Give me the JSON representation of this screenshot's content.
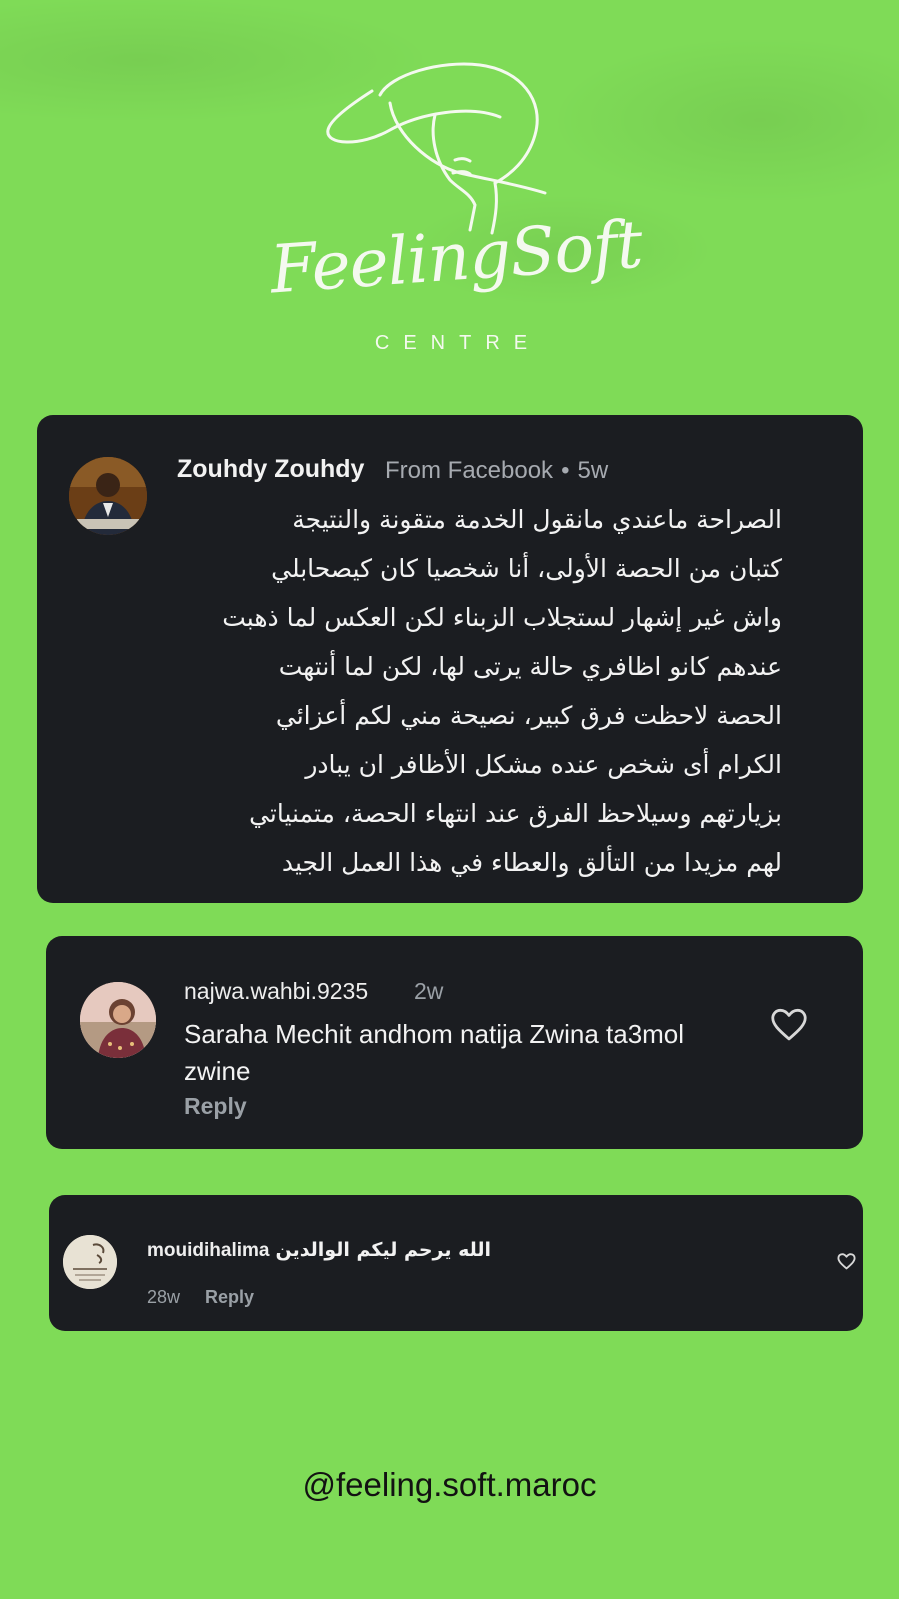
{
  "brand": {
    "title": "FeelingSoft",
    "subtitle": "CENTRE",
    "logo_icon": "woman-hat-icon",
    "background_color": "#7fdb57",
    "card_color": "#1b1d21"
  },
  "comments": [
    {
      "author": "Zouhdy Zouhdy",
      "source": "From Facebook",
      "separator": "•",
      "time": "5w",
      "avatar_icon": "avatar",
      "lines": [
        "الصراحة ماعندي مانقول الخدمة متقونة والنتيجة",
        "كتبان من الحصة الأولى، أنا شخصيا كان كيصحابلي",
        "واش غير إشهار لستجلاب الزبناء لكن العكس لما ذهبت",
        "عندهم كانو اظافري حالة يرتى لها، لكن لما أنتهت",
        "الحصة لاحظت فرق كبير، نصيحة مني لكم أعزائي",
        "الكرام أى شخص عنده مشكل الأظافر ان يبادر",
        "بزيارتهم وسيلاحظ الفرق عند انتهاء الحصة، متمنياتي",
        "لهم مزيدا من التألق والعطاء في هذا العمل الجيد"
      ]
    },
    {
      "author": "najwa.wahbi.9235",
      "time": "2w",
      "text": "Saraha Mechit andhom natija Zwina ta3mol zwine",
      "reply_label": "Reply",
      "like_icon": "heart-icon"
    },
    {
      "author": "mouidihalima",
      "text": "الله يرحم ليكم الوالدين",
      "time": "28w",
      "reply_label": "Reply",
      "like_icon": "heart-icon"
    }
  ],
  "footer": {
    "handle": "@feeling.soft.maroc"
  }
}
